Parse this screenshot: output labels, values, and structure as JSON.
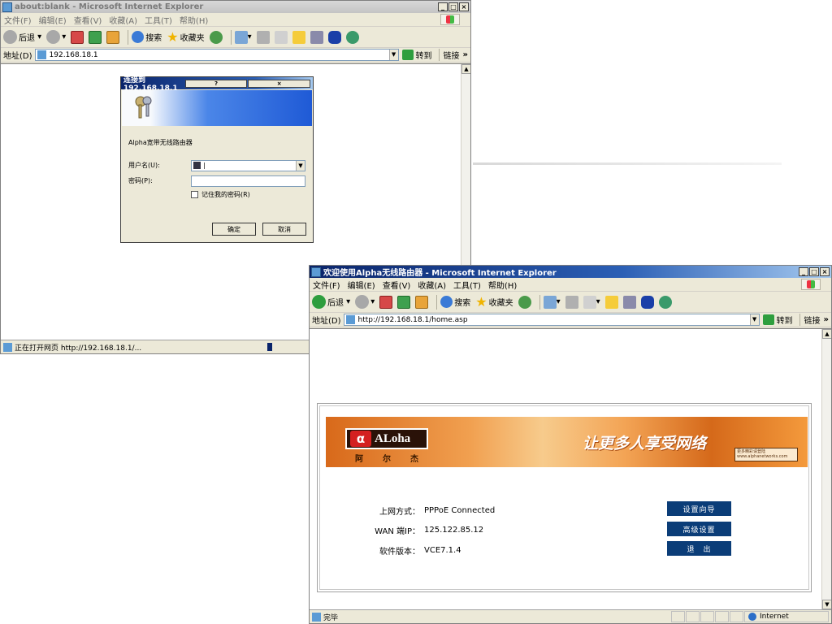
{
  "window1": {
    "title": "about:blank - Microsoft Internet Explorer",
    "menu": [
      "文件(F)",
      "编辑(E)",
      "查看(V)",
      "收藏(A)",
      "工具(T)",
      "帮助(H)"
    ],
    "toolbar": {
      "back": "后退",
      "search": "搜索",
      "favorites": "收藏夹"
    },
    "address_label": "地址(D)",
    "address": "192.168.18.1",
    "go": "转到",
    "links": "链接",
    "status": "正在打开网页 http://192.168.18.1/..."
  },
  "dialog": {
    "title": "连接到 192.168.18.1",
    "realm": "Alpha宽带无线路由器",
    "user_label": "用户名(U):",
    "password_label": "密码(P):",
    "remember_label": "记住我的密码(R)",
    "ok": "确定",
    "cancel": "取消"
  },
  "window2": {
    "title": "欢迎使用Alpha无线路由器 - Microsoft Internet Explorer",
    "menu": [
      "文件(F)",
      "编辑(E)",
      "查看(V)",
      "收藏(A)",
      "工具(T)",
      "帮助(H)"
    ],
    "toolbar": {
      "back": "后退",
      "search": "搜索",
      "favorites": "收藏夹"
    },
    "address_label": "地址(D)",
    "address": "http://192.168.18.1/home.asp",
    "go": "转到",
    "links": "链接",
    "status": "完毕",
    "zone": "Internet"
  },
  "router": {
    "logo": "ALoha",
    "logo_sub": "阿尔杰",
    "slogan": "让更多人享受网络",
    "stamp_text": "更多精彩请登陆 www.alphanetworks.com",
    "rows": [
      {
        "label": "上网方式：",
        "value": "PPPoE Connected"
      },
      {
        "label": "WAN 端IP：",
        "value": "125.122.85.12"
      },
      {
        "label": "软件版本：",
        "value": "VCE7.1.4"
      }
    ],
    "buttons": [
      "设置向导",
      "高级设置",
      "退　出"
    ]
  }
}
